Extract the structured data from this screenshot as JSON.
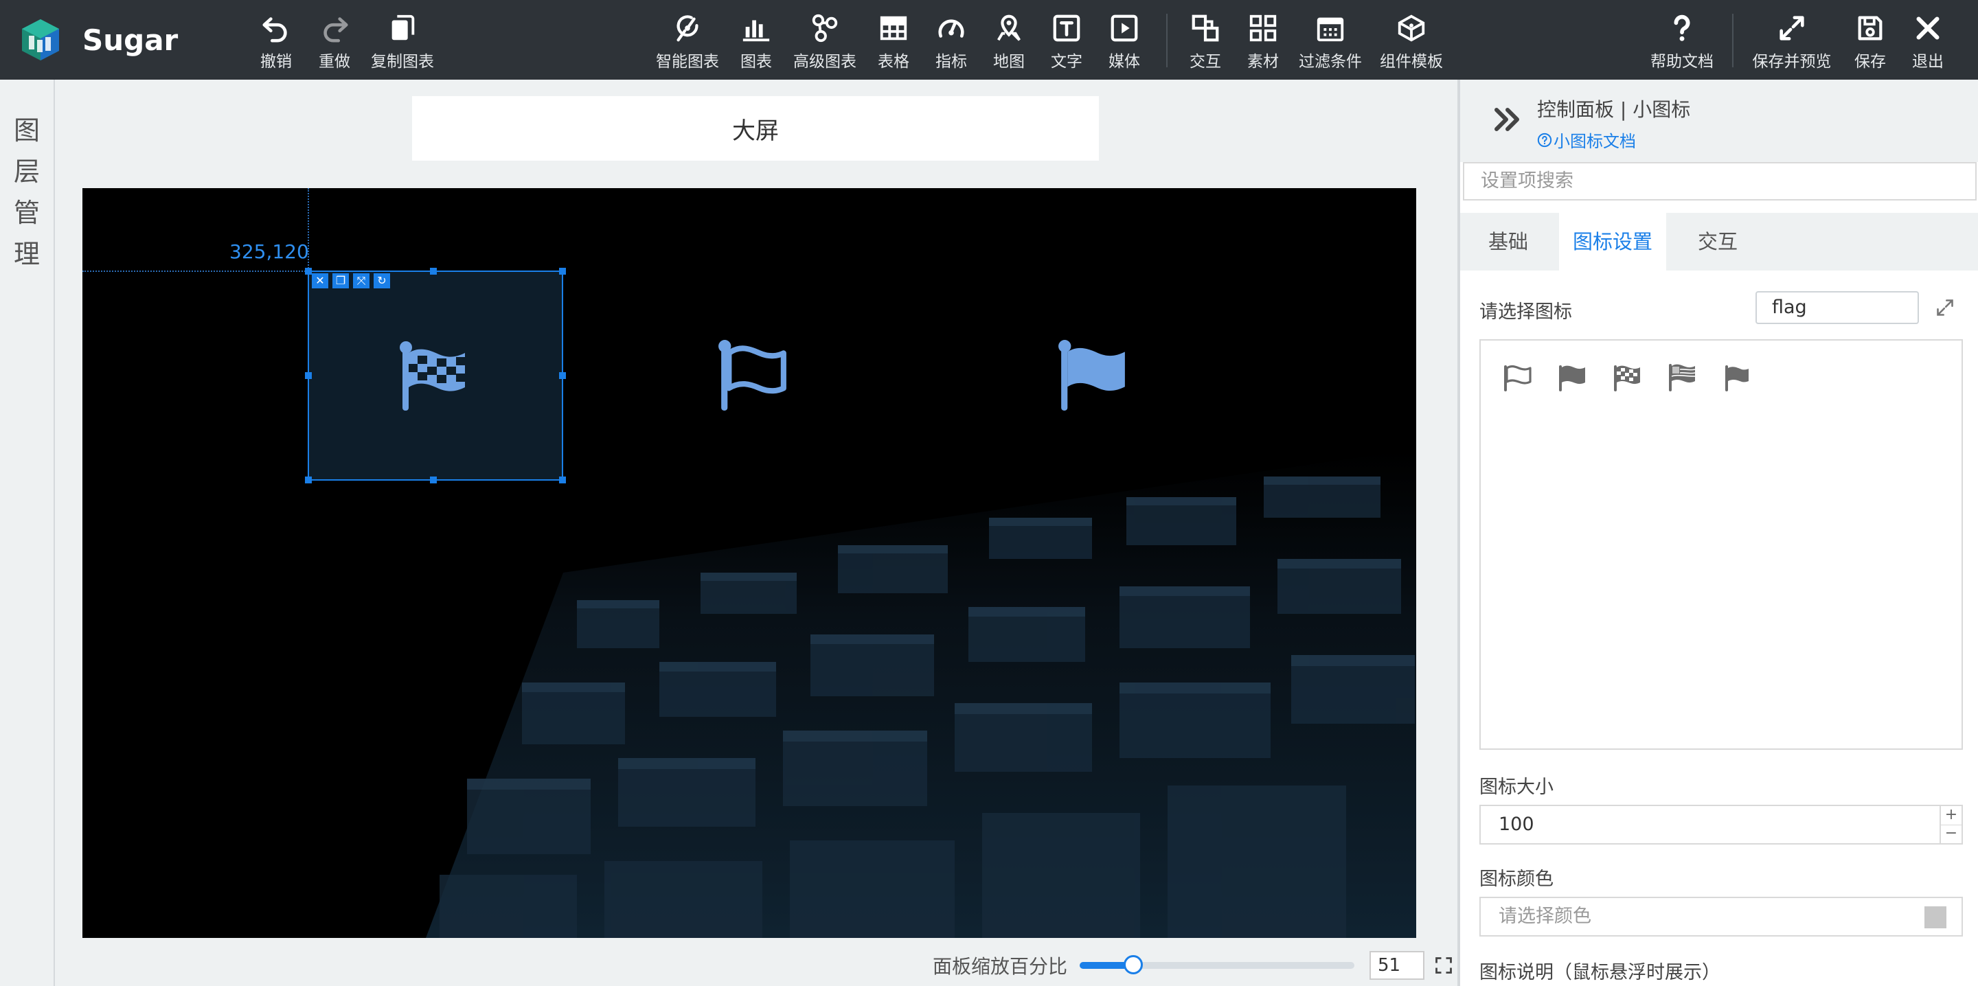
{
  "app": {
    "name": "Sugar"
  },
  "toolbar": {
    "undo": "撤销",
    "redo": "重做",
    "copy_chart": "复制图表",
    "smart_chart": "智能图表",
    "chart": "图表",
    "advanced_chart": "高级图表",
    "table": "表格",
    "indicator": "指标",
    "map": "地图",
    "text": "文字",
    "media": "媒体",
    "interaction": "交互",
    "assets": "素材",
    "filter": "过滤条件",
    "component_template": "组件模板",
    "help_doc": "帮助文档",
    "save_preview": "保存并预览",
    "save": "保存",
    "exit": "退出"
  },
  "layer_panel": {
    "label": [
      "图",
      "层",
      "管",
      "理"
    ]
  },
  "canvas": {
    "title": "大屏",
    "selection_coord": "325,120",
    "icon_color": "#6fa2e3"
  },
  "zoom": {
    "label": "面板缩放百分比",
    "value": "51",
    "percent": 51
  },
  "control_panel": {
    "title": "控制面板 | 小图标",
    "doc_link": "小图标文档",
    "search_placeholder": "设置项搜索",
    "tabs": [
      "基础",
      "图标设置",
      "交互"
    ],
    "active_tab": "图标设置",
    "choose_icon_label": "请选择图标",
    "icon_search_value": "flag",
    "icon_options": [
      "flag-outline-icon",
      "flag-solid-icon",
      "flag-checkered-icon",
      "flag-usa-icon",
      "font-awesome-flag-icon"
    ],
    "icon_size_label": "图标大小",
    "icon_size_value": "100",
    "icon_color_label": "图标颜色",
    "icon_color_placeholder": "请选择颜色",
    "icon_desc_label": "图标说明（鼠标悬浮时展示）"
  },
  "colors": {
    "accent": "#1a7fe8",
    "toolbar_bg": "#2e3338",
    "icon_gray": "#6b6b6b"
  }
}
